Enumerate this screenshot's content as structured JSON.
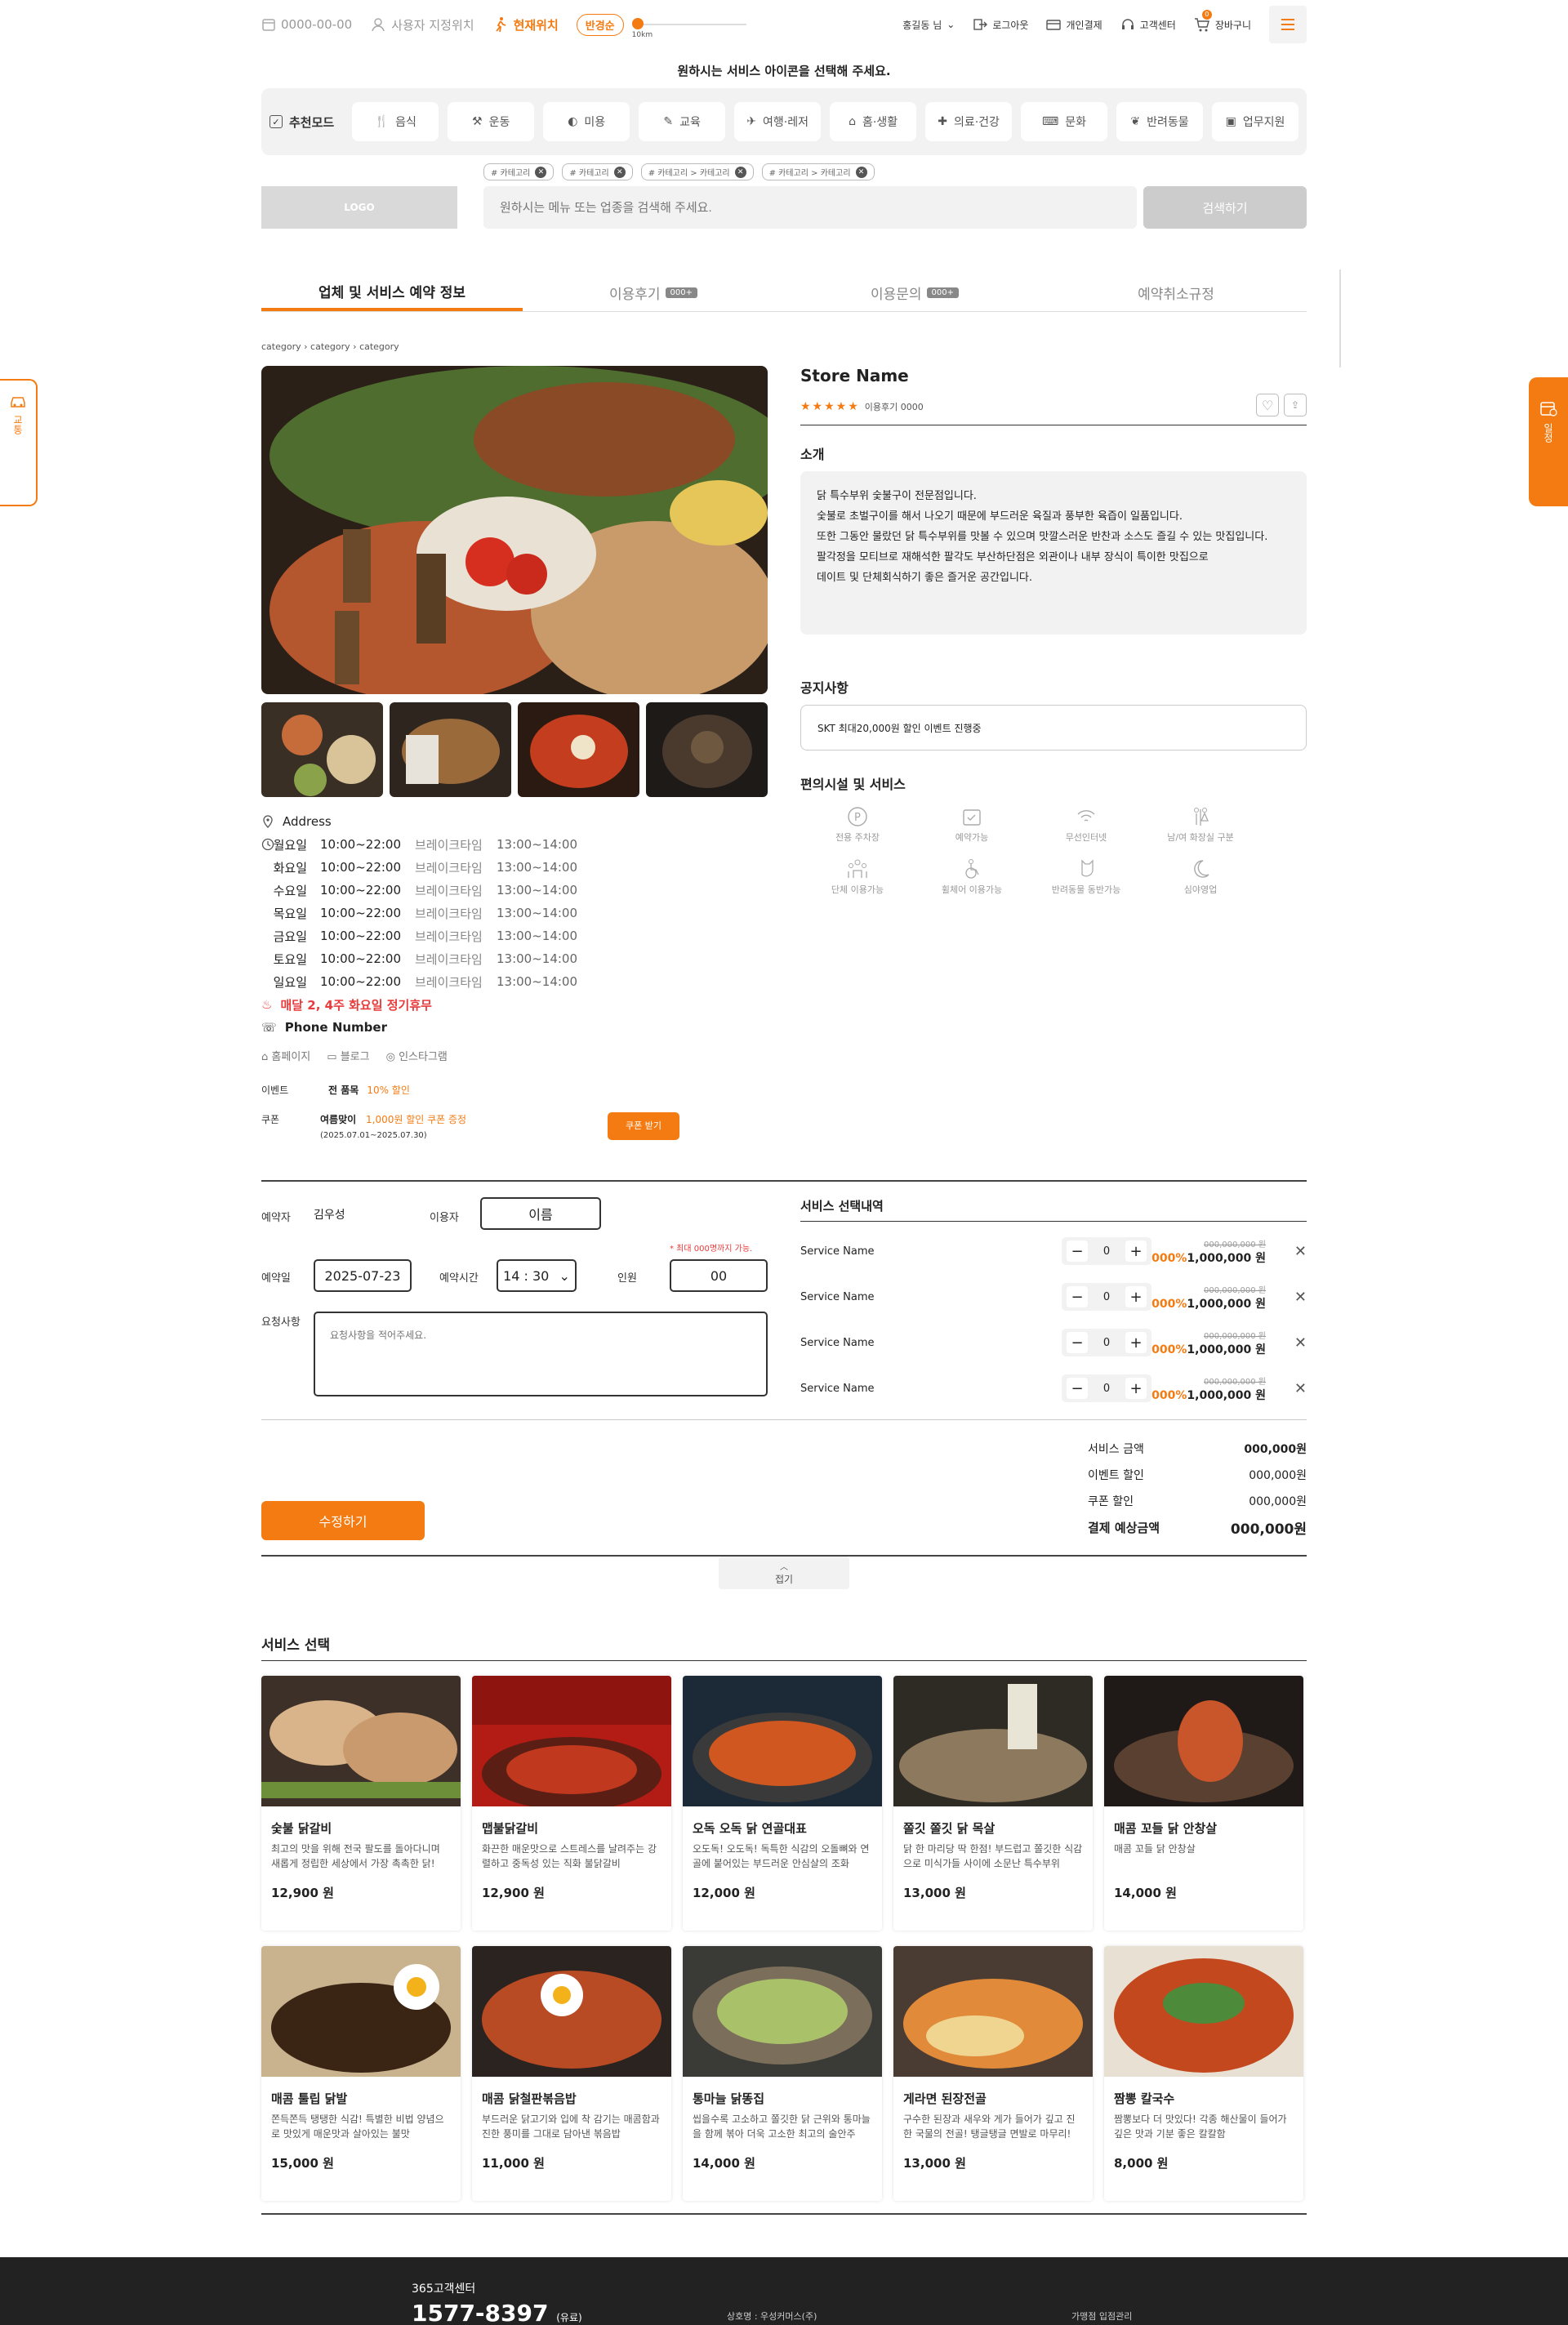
{
  "topbar": {
    "date": "0000-00-00",
    "user_location": "사용자 지정위치",
    "current_location": "현재위치",
    "radius_pill": "반경순",
    "slider_label": "10km",
    "user": "홍길동 님",
    "logout": "로그아웃",
    "payment": "개인결제",
    "support": "고객센터",
    "cart": "장바구니",
    "cart_count": "0"
  },
  "guide": "원하시는 서비스 아이콘을 선택해 주세요.",
  "categories": {
    "recommend": "추천모드",
    "items": [
      "음식",
      "운동",
      "미용",
      "교육",
      "여행·레저",
      "홈·생활",
      "의료·건강",
      "문화",
      "반려동물",
      "업무지원"
    ]
  },
  "chips": [
    "# 카테고리",
    "# 카테고리",
    "# 카테고리 > 카테고리",
    "# 카테고리 > 카테고리"
  ],
  "search": {
    "logo": "LOGO",
    "placeholder": "원하시는 메뉴 또는 업종을 검색해 주세요.",
    "button": "검색하기"
  },
  "tabs": [
    {
      "label": "업체 및 서비스 예약 정보",
      "count": ""
    },
    {
      "label": "이용후기",
      "count": "000+"
    },
    {
      "label": "이용문의",
      "count": "000+"
    },
    {
      "label": "예약취소규정",
      "count": ""
    }
  ],
  "breadcrumb": [
    "category",
    "category",
    "category"
  ],
  "info": {
    "address": "Address",
    "hours": [
      {
        "day": "월요일",
        "time": "10:00~22:00",
        "break_label": "브레이크타임",
        "break": "13:00~14:00"
      },
      {
        "day": "화요일",
        "time": "10:00~22:00",
        "break_label": "브레이크타임",
        "break": "13:00~14:00"
      },
      {
        "day": "수요일",
        "time": "10:00~22:00",
        "break_label": "브레이크타임",
        "break": "13:00~14:00"
      },
      {
        "day": "목요일",
        "time": "10:00~22:00",
        "break_label": "브레이크타임",
        "break": "13:00~14:00"
      },
      {
        "day": "금요일",
        "time": "10:00~22:00",
        "break_label": "브레이크타임",
        "break": "13:00~14:00"
      },
      {
        "day": "토요일",
        "time": "10:00~22:00",
        "break_label": "브레이크타임",
        "break": "13:00~14:00"
      },
      {
        "day": "일요일",
        "time": "10:00~22:00",
        "break_label": "브레이크타임",
        "break": "13:00~14:00"
      }
    ],
    "holiday": "매달 2, 4주 화요일 정기휴무",
    "phone": "Phone Number",
    "links": [
      "홈페이지",
      "블로그",
      "인스타그램"
    ],
    "event_label": "이벤트",
    "event_item": "전 품목",
    "event_value": "10% 할인",
    "coupon_label": "쿠폰",
    "coupon_name": "여름맞이",
    "coupon_value": "1,000원 할인 쿠폰 증정",
    "coupon_period": "(2025.07.01~2025.07.30)",
    "coupon_button": "쿠폰 받기"
  },
  "store": {
    "name": "Store Name",
    "stars": "★★★★★",
    "reviews": "이용후기 0000",
    "intro_title": "소개",
    "intro": [
      "닭 특수부위 숯불구이 전문점입니다.",
      "숯불로 초벌구이를 해서 나오기 때문에 부드러운 육질과 풍부한 육즙이 일품입니다.",
      "또한 그동안 물랐던 닭 특수부위를 맛볼 수 있으며 맛깔스러운 반찬과 소스도 즐길 수 있는 맛집입니다.",
      "팔각정을 모티브로 재해석한 팔각도 부산하단점은 외관이나 내부 장식이 특이한 맛집으로",
      "데이트 및 단체회식하기 좋은 즐거운 공간입니다."
    ],
    "notice_title": "공지사항",
    "notice": "SKT 최대20,000원 할인 이벤트 진행중",
    "fac_title": "편의시설 및 서비스",
    "facilities": [
      "전용 주차장",
      "예약가능",
      "무선인터넷",
      "남/여 화장실 구분",
      "단체 이용가능",
      "휠체어 이용가능",
      "반려동물 동반가능",
      "심야영업"
    ]
  },
  "reserve": {
    "booker_label": "예약자",
    "booker": "김우성",
    "user_label": "이용자",
    "user_value": "이름",
    "date_label": "예약일",
    "date": "2025-07-23",
    "time_label": "예약시간",
    "time": "14 : 30",
    "people_label": "인원",
    "people_hint": "* 최대 000명까지 가능.",
    "people": "00",
    "request_label": "요청사항",
    "request_placeholder": "요청사항을 적어주세요."
  },
  "services": {
    "title": "서비스 선택내역",
    "rows": [
      {
        "name": "Service Name",
        "qty": "0",
        "orig": "000,000,000 원",
        "pct": "000%",
        "price": "1,000,000 원"
      },
      {
        "name": "Service Name",
        "qty": "0",
        "orig": "000,000,000 원",
        "pct": "000%",
        "price": "1,000,000 원"
      },
      {
        "name": "Service Name",
        "qty": "0",
        "orig": "000,000,000 원",
        "pct": "000%",
        "price": "1,000,000 원"
      },
      {
        "name": "Service Name",
        "qty": "0",
        "orig": "000,000,000 원",
        "pct": "000%",
        "price": "1,000,000 원"
      }
    ]
  },
  "summary": {
    "rows": [
      {
        "label": "서비스 금액",
        "value": "000,000원"
      },
      {
        "label": "이벤트 할인",
        "value": "000,000원"
      },
      {
        "label": "쿠폰 할인",
        "value": "000,000원"
      },
      {
        "label": "결제 예상금액",
        "value": "000,000원"
      }
    ],
    "edit_button": "수정하기",
    "fold": "접기"
  },
  "menu": {
    "title": "서비스 선택",
    "items": [
      {
        "name": "숯불 닭갈비",
        "desc": "최고의 맛을 위해 전국 팔도를 돌아다니며 새롭게 정립한 세상에서 가장 촉촉한 닭!",
        "price": "12,900 원"
      },
      {
        "name": "맵불닭갈비",
        "desc": "화끈한 매운맛으로 스트레스를 날려주는 강렬하고 중독성 있는 직화 불닭갈비",
        "price": "12,900 원"
      },
      {
        "name": "오독 오독 닭 연골대표",
        "desc": "오도독! 오도독! 독특한 식감의 오돌뼈와 연골에 붙어있는 부드러운 안심살의 조화",
        "price": "12,000 원"
      },
      {
        "name": "쫄깃 쫄깃 닭 목살",
        "desc": "닭 한 마리당 딱 한점! 부드럽고 쫄깃한 식감으로 미식가들 사이에 소문난 특수부위",
        "price": "13,000 원"
      },
      {
        "name": "매콤 꼬들 닭 안창살",
        "desc": "매콤 꼬들 닭 안창살",
        "price": "14,000 원"
      },
      {
        "name": "매콤 툴립 닭발",
        "desc": "쫀득쫀득 탱탱한 식감! 특별한 비법 양념으로 맛있게 매운맛과 살아있는 불맛",
        "price": "15,000 원"
      },
      {
        "name": "매콤 닭철판볶음밥",
        "desc": "부드러운 닭고기와 입에 착 감기는 매콤함과 진한 풍미를 그대로 담아낸 볶음밥",
        "price": "11,000 원"
      },
      {
        "name": "통마늘 닭똥집",
        "desc": "씹을수록 고소하고 쫄깃한 닭 근위와 통마늘을 함께 볶아 더욱 고소한 최고의 술안주",
        "price": "14,000 원"
      },
      {
        "name": "게라면 된장전골",
        "desc": "구수한 된장과 새우와 게가 들어가 깊고 진한 국물의 전골! 탱글탱글 면발로 마무리!",
        "price": "13,000 원"
      },
      {
        "name": "짬뽕 칼국수",
        "desc": "짬뽕보다 더 맛있다! 각종 해산물이 들어가 깊은 맛과 기분 좋은 칼칼함",
        "price": "8,000 원"
      }
    ]
  },
  "footer": {
    "center": "365고객센터",
    "phone": "1577-8397",
    "phone_note": "(유료)",
    "company": "상호명 : 우성커머스(주)",
    "apply": "가맹점 입점관리"
  },
  "side": {
    "left": "교통",
    "right": "일정"
  },
  "colors": {
    "accent": "#f47b12",
    "holiday": "#e83b3b"
  }
}
